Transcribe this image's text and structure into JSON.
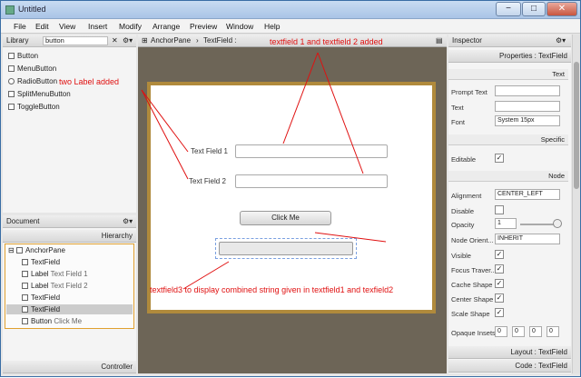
{
  "window": {
    "title": "Untitled",
    "min": "−",
    "max": "□",
    "close": "✕"
  },
  "menu": [
    "File",
    "Edit",
    "View",
    "Insert",
    "Modify",
    "Arrange",
    "Preview",
    "Window",
    "Help"
  ],
  "library": {
    "title": "Library",
    "search_value": "button",
    "gear": "⚙▾",
    "items": [
      "Button",
      "MenuButton",
      "RadioButton",
      "SplitMenuButton",
      "ToggleButton"
    ]
  },
  "document": {
    "title": "Document",
    "gear": "⚙▾",
    "hierarchy_tab": "Hierarchy",
    "controller_tab": "Controller",
    "tree": [
      {
        "type": "AnchorPane",
        "label": ""
      },
      {
        "type": "TextField",
        "label": ""
      },
      {
        "type": "Label",
        "label": "Text Field 1"
      },
      {
        "type": "Label",
        "label": "Text Field 2"
      },
      {
        "type": "TextField",
        "label": ""
      },
      {
        "type": "TextField",
        "label": ""
      },
      {
        "type": "Button",
        "label": "Click Me"
      }
    ]
  },
  "breadcrumb": {
    "root": "AnchorPane",
    "sep": "›",
    "current": "TextField :"
  },
  "canvas": {
    "label1": "Text Field 1",
    "label2": "Text Field 2",
    "button": "Click Me"
  },
  "inspector": {
    "title": "Inspector",
    "properties_header": "Properties : TextField",
    "section_text": "Text",
    "prompt_text": "Prompt Text",
    "text": "Text",
    "font": "Font",
    "font_value": "System 15px",
    "section_specific": "Specific",
    "editable": "Editable",
    "section_node": "Node",
    "alignment": "Alignment",
    "alignment_value": "CENTER_LEFT",
    "disable": "Disable",
    "opacity": "Opacity",
    "opacity_value": "1",
    "node_orient": "Node Orient...",
    "node_orient_value": "INHERIT",
    "visible": "Visible",
    "focus": "Focus Traver...",
    "cache": "Cache Shape",
    "center": "Center Shape",
    "scale": "Scale Shape",
    "opaque": "Opaque Insets",
    "insets": [
      "0",
      "0",
      "0",
      "0"
    ],
    "layout_header": "Layout : TextField",
    "code_header": "Code : TextField",
    "check": "✓"
  },
  "annotations": {
    "top": "textfield 1 and textfield 2 added",
    "labels": "two Label added",
    "textfield3": "textfield3 to display combined string given in textfield1 and texfield2"
  }
}
